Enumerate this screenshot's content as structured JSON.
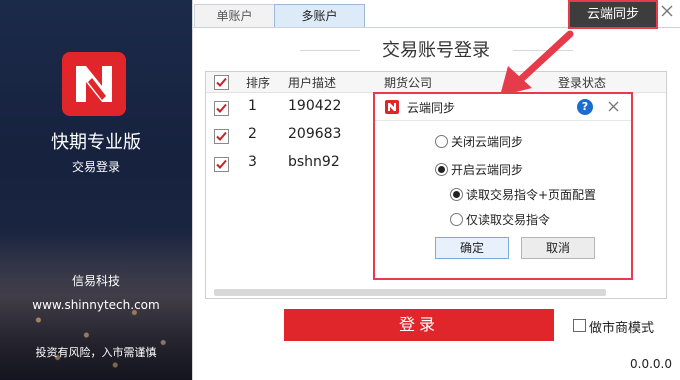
{
  "brand": {
    "title": "快期专业版",
    "subtitle": "交易登录",
    "company": "信易科技",
    "website": "www.shinnytech.com",
    "risk_notice": "投资有风险，入市需谨慎"
  },
  "tabs": [
    {
      "label": "单账户",
      "active": false
    },
    {
      "label": "多账户",
      "active": true
    }
  ],
  "cloud_sync_button": "云端同步",
  "heading": "交易账号登录",
  "table": {
    "columns": [
      "排序",
      "用户描述",
      "期货公司",
      "登录状态"
    ],
    "header_checked": true,
    "rows": [
      {
        "checked": true,
        "order": "1",
        "user": "190422"
      },
      {
        "checked": true,
        "order": "2",
        "user": "209683"
      },
      {
        "checked": true,
        "order": "3",
        "user": "bshn92"
      }
    ]
  },
  "dialog": {
    "title": "云端同步",
    "help_label": "?",
    "options": {
      "off": {
        "label": "关闭云端同步",
        "selected": false
      },
      "on": {
        "label": "开启云端同步",
        "selected": true
      },
      "read_all": {
        "label": "读取交易指令+页面配置",
        "selected": true
      },
      "read_orders": {
        "label": "仅读取交易指令",
        "selected": false
      }
    },
    "ok_label": "确定",
    "cancel_label": "取消"
  },
  "login_button": "登录",
  "market_maker": {
    "label": "做市商模式",
    "checked": false
  },
  "version": "0.0.0.0",
  "colors": {
    "accent_red": "#e0262a",
    "highlight_red": "#e53b4b",
    "sync_button_bg": "#3d3d3d"
  }
}
